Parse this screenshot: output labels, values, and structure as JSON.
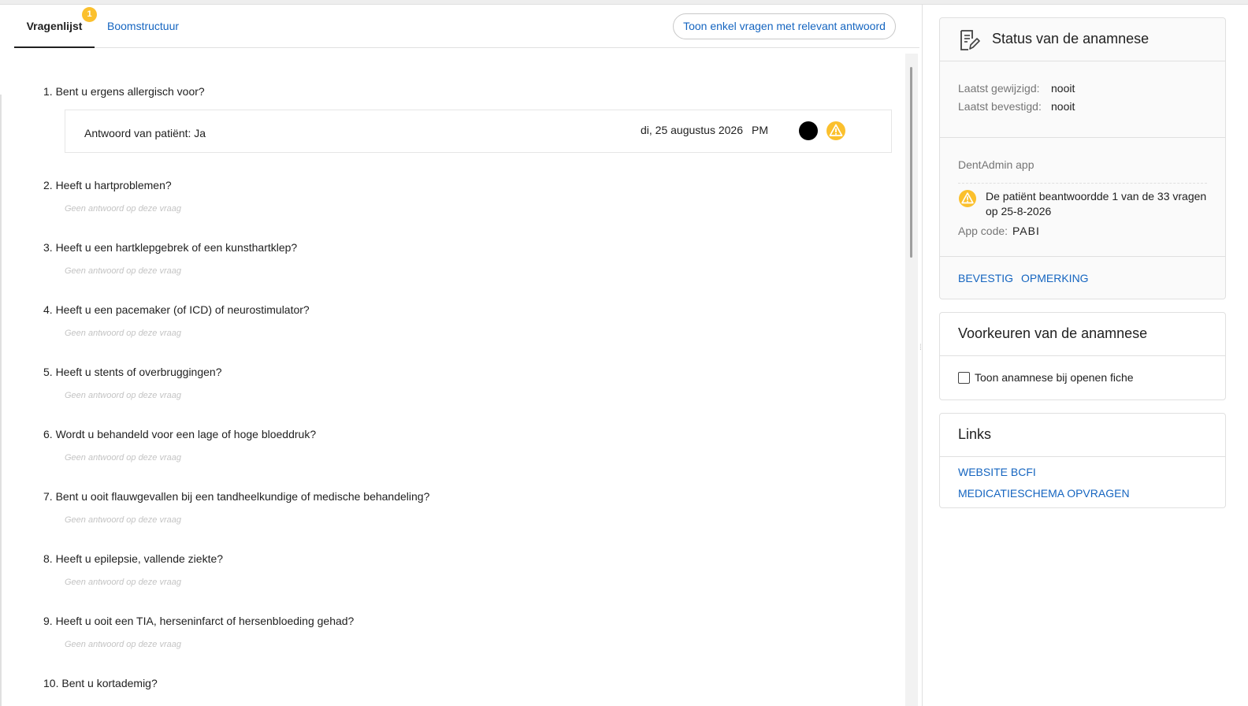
{
  "tabs": {
    "active_label": "Vragenlijst",
    "active_badge": "1",
    "inactive_label": "Boomstructuur",
    "filter_button": "Toon enkel vragen met relevant antwoord"
  },
  "questions": [
    {
      "text": "1. Bent u ergens allergisch voor?"
    },
    {
      "text": "2. Heeft u hartproblemen?"
    },
    {
      "text": "3. Heeft u een hartklepgebrek of een kunsthartklep?"
    },
    {
      "text": "4. Heeft u een pacemaker (of ICD) of neurostimulator?"
    },
    {
      "text": "5. Heeft u stents of overbruggingen?"
    },
    {
      "text": "6. Wordt u behandeld voor een lage of hoge bloeddruk?"
    },
    {
      "text": "7. Bent u ooit flauwgevallen bij een tandheelkundige of medische behandeling?"
    },
    {
      "text": "8. Heeft u epilepsie, vallende ziekte?"
    },
    {
      "text": "9. Heeft u ooit een TIA, herseninfarct of hersenbloeding gehad?"
    },
    {
      "text": "10. Bent u kortademig?"
    }
  ],
  "no_answer_text": "Geen antwoord op deze vraag",
  "answer": {
    "text": "Antwoord van patiënt: Ja",
    "date": "di, 25 augustus 2026",
    "ampm": "PM"
  },
  "status_card": {
    "title": "Status van de anamnese",
    "last_modified_label": "Laatst gewijzigd:",
    "last_modified_value": "nooit",
    "last_confirmed_label": "Laatst bevestigd:",
    "last_confirmed_value": "nooit",
    "app_title": "DentAdmin app",
    "app_message": "De patiënt beantwoordde 1 van de 33 vragen op 25-8-2026",
    "app_code_label": "App code:",
    "app_code_value": "PABI",
    "confirm_label": "BEVESTIG",
    "remark_label": "OPMERKING"
  },
  "preferences_card": {
    "title": "Voorkeuren van de anamnese",
    "checkbox_label": "Toon anamnese bij openen fiche",
    "checkbox_checked": false
  },
  "links_card": {
    "title": "Links",
    "items": [
      "WEBSITE BCFI",
      "MEDICATIESCHEMA OPVRAGEN"
    ]
  },
  "colors": {
    "link": "#1565c0",
    "warning": "#fbc02d",
    "muted_text": "#757575",
    "placeholder": "#c4c4c4"
  }
}
